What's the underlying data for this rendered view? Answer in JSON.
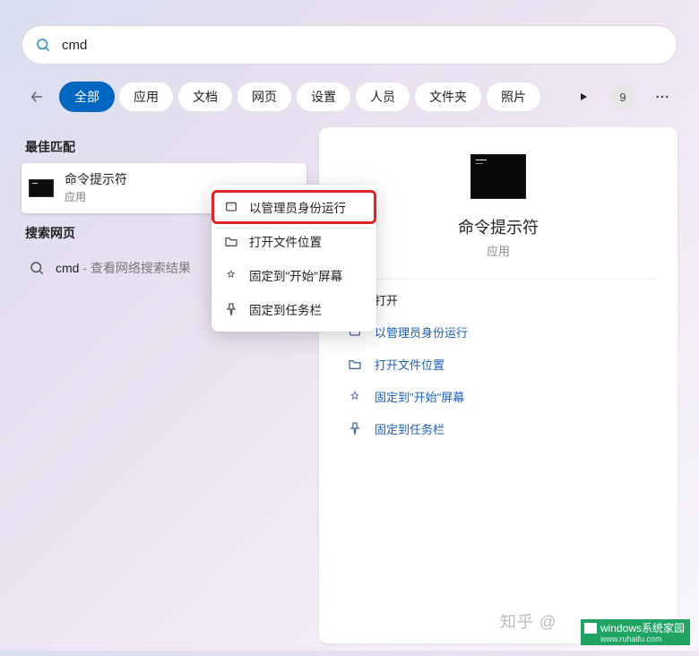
{
  "search": {
    "value": "cmd"
  },
  "tabs": {
    "items": [
      "全部",
      "应用",
      "文档",
      "网页",
      "设置",
      "人员",
      "文件夹",
      "照片"
    ],
    "count": "9"
  },
  "left": {
    "best_match_header": "最佳匹配",
    "best_match": {
      "title": "命令提示符",
      "sub": "应用"
    },
    "web_header": "搜索网页",
    "web_item": {
      "query": "cmd",
      "suffix": " - 查看网络搜索结果"
    }
  },
  "details": {
    "title": "命令提示符",
    "sub": "应用",
    "actions": [
      "打开",
      "以管理员身份运行",
      "打开文件位置",
      "固定到\"开始\"屏幕",
      "固定到任务栏"
    ]
  },
  "context": {
    "items": [
      "以管理员身份运行",
      "打开文件位置",
      "固定到\"开始\"屏幕",
      "固定到任务栏"
    ]
  },
  "watermark": {
    "zhihu": "知乎 @",
    "brand": "windows系统家园",
    "brand_sub": "www.ruhaifu.com"
  }
}
